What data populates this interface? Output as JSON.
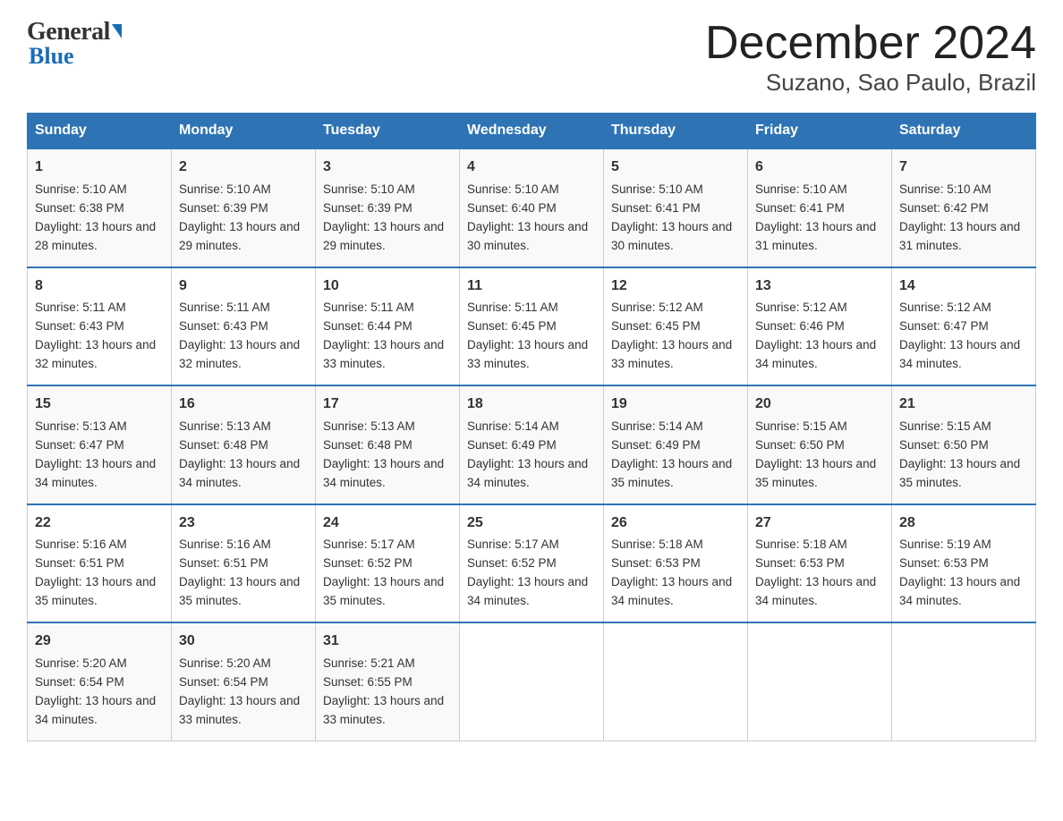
{
  "header": {
    "logo_general": "General",
    "logo_blue": "Blue",
    "title": "December 2024",
    "subtitle": "Suzano, Sao Paulo, Brazil"
  },
  "days_of_week": [
    "Sunday",
    "Monday",
    "Tuesday",
    "Wednesday",
    "Thursday",
    "Friday",
    "Saturday"
  ],
  "weeks": [
    [
      {
        "day": "1",
        "sunrise": "Sunrise: 5:10 AM",
        "sunset": "Sunset: 6:38 PM",
        "daylight": "Daylight: 13 hours and 28 minutes."
      },
      {
        "day": "2",
        "sunrise": "Sunrise: 5:10 AM",
        "sunset": "Sunset: 6:39 PM",
        "daylight": "Daylight: 13 hours and 29 minutes."
      },
      {
        "day": "3",
        "sunrise": "Sunrise: 5:10 AM",
        "sunset": "Sunset: 6:39 PM",
        "daylight": "Daylight: 13 hours and 29 minutes."
      },
      {
        "day": "4",
        "sunrise": "Sunrise: 5:10 AM",
        "sunset": "Sunset: 6:40 PM",
        "daylight": "Daylight: 13 hours and 30 minutes."
      },
      {
        "day": "5",
        "sunrise": "Sunrise: 5:10 AM",
        "sunset": "Sunset: 6:41 PM",
        "daylight": "Daylight: 13 hours and 30 minutes."
      },
      {
        "day": "6",
        "sunrise": "Sunrise: 5:10 AM",
        "sunset": "Sunset: 6:41 PM",
        "daylight": "Daylight: 13 hours and 31 minutes."
      },
      {
        "day": "7",
        "sunrise": "Sunrise: 5:10 AM",
        "sunset": "Sunset: 6:42 PM",
        "daylight": "Daylight: 13 hours and 31 minutes."
      }
    ],
    [
      {
        "day": "8",
        "sunrise": "Sunrise: 5:11 AM",
        "sunset": "Sunset: 6:43 PM",
        "daylight": "Daylight: 13 hours and 32 minutes."
      },
      {
        "day": "9",
        "sunrise": "Sunrise: 5:11 AM",
        "sunset": "Sunset: 6:43 PM",
        "daylight": "Daylight: 13 hours and 32 minutes."
      },
      {
        "day": "10",
        "sunrise": "Sunrise: 5:11 AM",
        "sunset": "Sunset: 6:44 PM",
        "daylight": "Daylight: 13 hours and 33 minutes."
      },
      {
        "day": "11",
        "sunrise": "Sunrise: 5:11 AM",
        "sunset": "Sunset: 6:45 PM",
        "daylight": "Daylight: 13 hours and 33 minutes."
      },
      {
        "day": "12",
        "sunrise": "Sunrise: 5:12 AM",
        "sunset": "Sunset: 6:45 PM",
        "daylight": "Daylight: 13 hours and 33 minutes."
      },
      {
        "day": "13",
        "sunrise": "Sunrise: 5:12 AM",
        "sunset": "Sunset: 6:46 PM",
        "daylight": "Daylight: 13 hours and 34 minutes."
      },
      {
        "day": "14",
        "sunrise": "Sunrise: 5:12 AM",
        "sunset": "Sunset: 6:47 PM",
        "daylight": "Daylight: 13 hours and 34 minutes."
      }
    ],
    [
      {
        "day": "15",
        "sunrise": "Sunrise: 5:13 AM",
        "sunset": "Sunset: 6:47 PM",
        "daylight": "Daylight: 13 hours and 34 minutes."
      },
      {
        "day": "16",
        "sunrise": "Sunrise: 5:13 AM",
        "sunset": "Sunset: 6:48 PM",
        "daylight": "Daylight: 13 hours and 34 minutes."
      },
      {
        "day": "17",
        "sunrise": "Sunrise: 5:13 AM",
        "sunset": "Sunset: 6:48 PM",
        "daylight": "Daylight: 13 hours and 34 minutes."
      },
      {
        "day": "18",
        "sunrise": "Sunrise: 5:14 AM",
        "sunset": "Sunset: 6:49 PM",
        "daylight": "Daylight: 13 hours and 34 minutes."
      },
      {
        "day": "19",
        "sunrise": "Sunrise: 5:14 AM",
        "sunset": "Sunset: 6:49 PM",
        "daylight": "Daylight: 13 hours and 35 minutes."
      },
      {
        "day": "20",
        "sunrise": "Sunrise: 5:15 AM",
        "sunset": "Sunset: 6:50 PM",
        "daylight": "Daylight: 13 hours and 35 minutes."
      },
      {
        "day": "21",
        "sunrise": "Sunrise: 5:15 AM",
        "sunset": "Sunset: 6:50 PM",
        "daylight": "Daylight: 13 hours and 35 minutes."
      }
    ],
    [
      {
        "day": "22",
        "sunrise": "Sunrise: 5:16 AM",
        "sunset": "Sunset: 6:51 PM",
        "daylight": "Daylight: 13 hours and 35 minutes."
      },
      {
        "day": "23",
        "sunrise": "Sunrise: 5:16 AM",
        "sunset": "Sunset: 6:51 PM",
        "daylight": "Daylight: 13 hours and 35 minutes."
      },
      {
        "day": "24",
        "sunrise": "Sunrise: 5:17 AM",
        "sunset": "Sunset: 6:52 PM",
        "daylight": "Daylight: 13 hours and 35 minutes."
      },
      {
        "day": "25",
        "sunrise": "Sunrise: 5:17 AM",
        "sunset": "Sunset: 6:52 PM",
        "daylight": "Daylight: 13 hours and 34 minutes."
      },
      {
        "day": "26",
        "sunrise": "Sunrise: 5:18 AM",
        "sunset": "Sunset: 6:53 PM",
        "daylight": "Daylight: 13 hours and 34 minutes."
      },
      {
        "day": "27",
        "sunrise": "Sunrise: 5:18 AM",
        "sunset": "Sunset: 6:53 PM",
        "daylight": "Daylight: 13 hours and 34 minutes."
      },
      {
        "day": "28",
        "sunrise": "Sunrise: 5:19 AM",
        "sunset": "Sunset: 6:53 PM",
        "daylight": "Daylight: 13 hours and 34 minutes."
      }
    ],
    [
      {
        "day": "29",
        "sunrise": "Sunrise: 5:20 AM",
        "sunset": "Sunset: 6:54 PM",
        "daylight": "Daylight: 13 hours and 34 minutes."
      },
      {
        "day": "30",
        "sunrise": "Sunrise: 5:20 AM",
        "sunset": "Sunset: 6:54 PM",
        "daylight": "Daylight: 13 hours and 33 minutes."
      },
      {
        "day": "31",
        "sunrise": "Sunrise: 5:21 AM",
        "sunset": "Sunset: 6:55 PM",
        "daylight": "Daylight: 13 hours and 33 minutes."
      },
      null,
      null,
      null,
      null
    ]
  ]
}
